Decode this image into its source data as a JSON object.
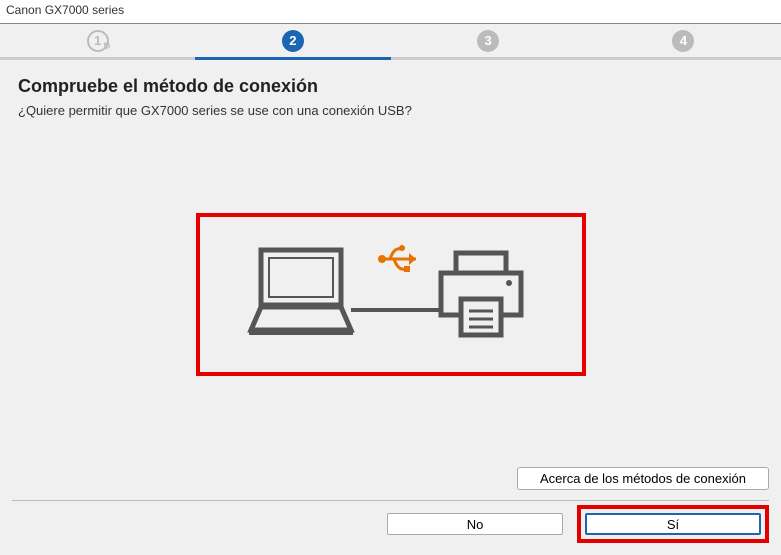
{
  "window": {
    "title": "Canon GX7000 series"
  },
  "stepper": {
    "steps": [
      {
        "num": "1",
        "state": "done"
      },
      {
        "num": "2",
        "state": "active"
      },
      {
        "num": "3",
        "state": "pending"
      },
      {
        "num": "4",
        "state": "pending"
      }
    ]
  },
  "page": {
    "heading": "Compruebe el método de conexión",
    "subtext": "¿Quiere permitir que GX7000 series se use con una conexión USB?"
  },
  "info_button": {
    "label": "Acerca de los métodos de conexión"
  },
  "buttons": {
    "no": "No",
    "yes": "Sí"
  }
}
